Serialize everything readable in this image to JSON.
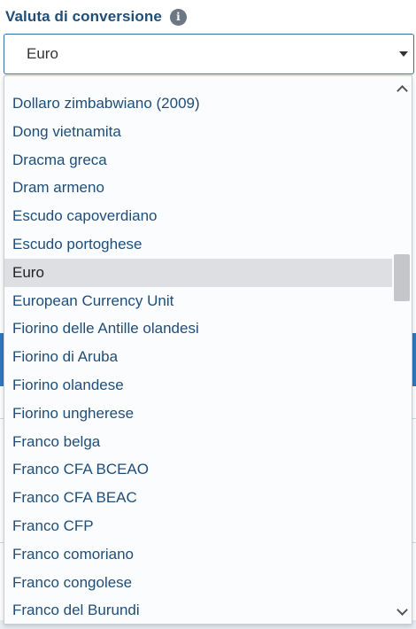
{
  "field": {
    "label": "Valuta di conversione",
    "info_icon": "info-icon",
    "selected_value": "Euro"
  },
  "dropdown": {
    "options": [
      "Dollaro zimbabwiano (2009)",
      "Dong vietnamita",
      "Dracma greca",
      "Dram armeno",
      "Escudo capoverdiano",
      "Escudo portoghese",
      "Euro",
      "European Currency Unit",
      "Fiorino delle Antille olandesi",
      "Fiorino di Aruba",
      "Fiorino olandese",
      "Fiorino ungherese",
      "Franco belga",
      "Franco CFA BCEAO",
      "Franco CFA BEAC",
      "Franco CFP",
      "Franco comoriano",
      "Franco congolese",
      "Franco del Burundi"
    ],
    "selected_index": 6,
    "scroll_up_icon": "chevron-up-icon",
    "scroll_down_icon": "chevron-down-icon"
  },
  "colors": {
    "label": "#1f4e79",
    "option_text": "#1f4e79",
    "selected_bg": "#dedfe3",
    "select_border": "#2f6fb0",
    "background_accent": "#2f78c4"
  }
}
